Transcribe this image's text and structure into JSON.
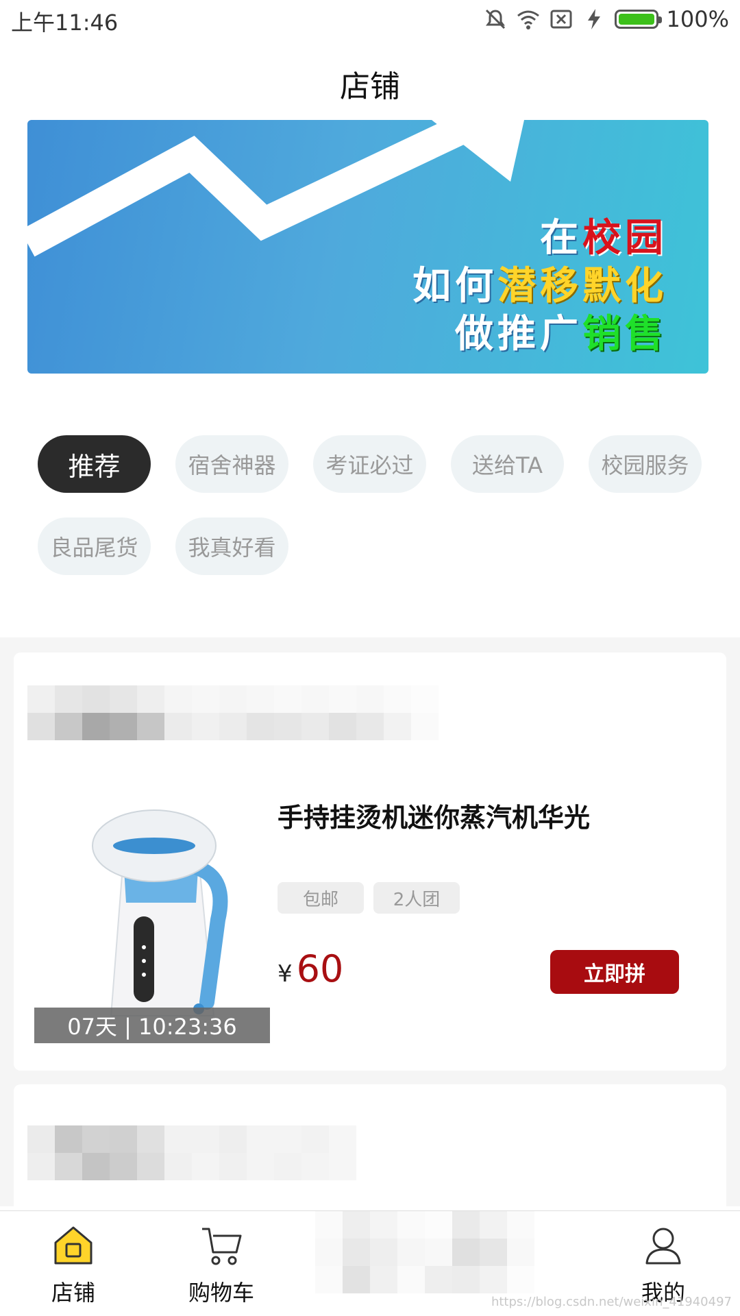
{
  "status_bar": {
    "time": "上午11:46",
    "battery": "100%"
  },
  "header": {
    "title": "店铺"
  },
  "banner": {
    "line1_a": "在",
    "line1_b": "校园",
    "line2_a": "如何",
    "line2_b": "潜移默化",
    "line3_a": "做推广",
    "line3_b": "销售"
  },
  "categories": [
    "推荐",
    "宿舍神器",
    "考证必过",
    "送给TA",
    "校园服务",
    "良品尾货",
    "我真好看"
  ],
  "product": {
    "name": "手持挂烫机迷你蒸汽机华光",
    "tags": [
      "包邮",
      "2人团"
    ],
    "currency": "¥",
    "price": "60",
    "countdown": "07天 | 10:23:36",
    "button": "立即拼"
  },
  "tabbar": {
    "items": [
      "店铺",
      "购物车",
      "我的"
    ]
  },
  "watermark": "https://blog.csdn.net/weixin_41940497",
  "colors": {
    "accent": "#a80c10",
    "active_tag": "#2b2b2b",
    "tag_bg": "#eef3f5",
    "home_icon": "#ffd42a"
  }
}
